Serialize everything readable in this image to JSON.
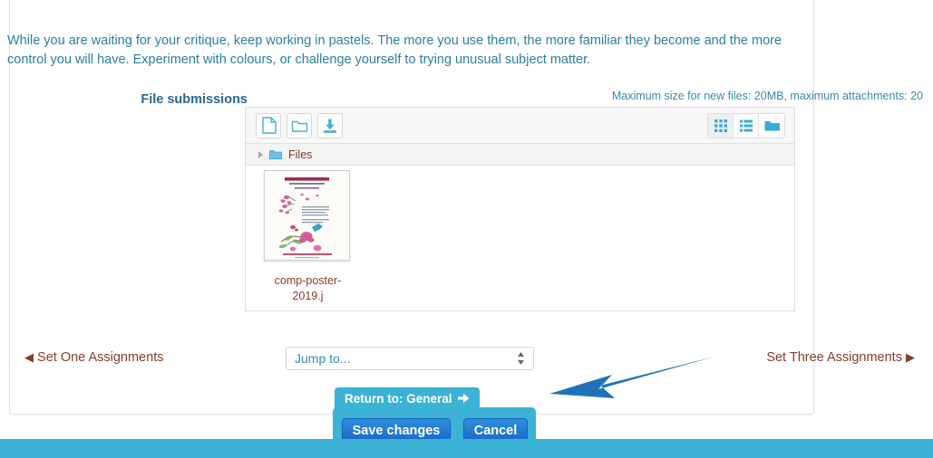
{
  "intro": {
    "paragraph": "While you are waiting for your critique, keep working in pastels. The more you use them, the more familiar they become and the more control you will have. Experiment with colours, or challenge yourself to trying unusual subject matter."
  },
  "submission": {
    "label": "File submissions",
    "max_size_note": "Maximum size for new files: 20MB, maximum attachments: 20"
  },
  "filemanager": {
    "toolbar": [
      {
        "name": "add-file-icon",
        "title": "Add..."
      },
      {
        "name": "create-folder-icon",
        "title": "Create folder"
      },
      {
        "name": "download-all-icon",
        "title": "Download all"
      }
    ],
    "view_modes": [
      {
        "name": "grid-view-icon",
        "label": "Display folder with file icons",
        "active": true
      },
      {
        "name": "list-view-icon",
        "label": "Display folder with file details",
        "active": false
      },
      {
        "name": "tree-view-icon",
        "label": "Display as tree",
        "active": false
      }
    ],
    "breadcrumb": "Files",
    "files": [
      {
        "name": "comp-poster-2019.j",
        "display_line_1": "comp-poster-",
        "display_line_2": "2019.j",
        "thumbnail": {
          "title": "COMPETITION TIME",
          "subtitle": "PASTEL AND DRAWING OR PAINTING",
          "caption": "THE 2019 CONCERT",
          "footer": "1st Prize £500  2nd Prize £250"
        }
      }
    ]
  },
  "navigation": {
    "prev_arrow": "◀",
    "prev_label": "Set One Assignments",
    "jump_to": "Jump to...",
    "next_label": "Set Three Assignments",
    "next_arrow": "▶"
  },
  "tooltip": {
    "text": "Return to: General",
    "icon": "⭢"
  },
  "actions": {
    "save_label": "Save changes",
    "cancel_label": "Cancel"
  },
  "colors": {
    "accent_cyan": "#3bb2d6",
    "link_brown": "#8a3b2b",
    "text_teal": "#2a7f9e",
    "button_blue": "#1767c6",
    "annotation_blue": "#1f72b8"
  }
}
